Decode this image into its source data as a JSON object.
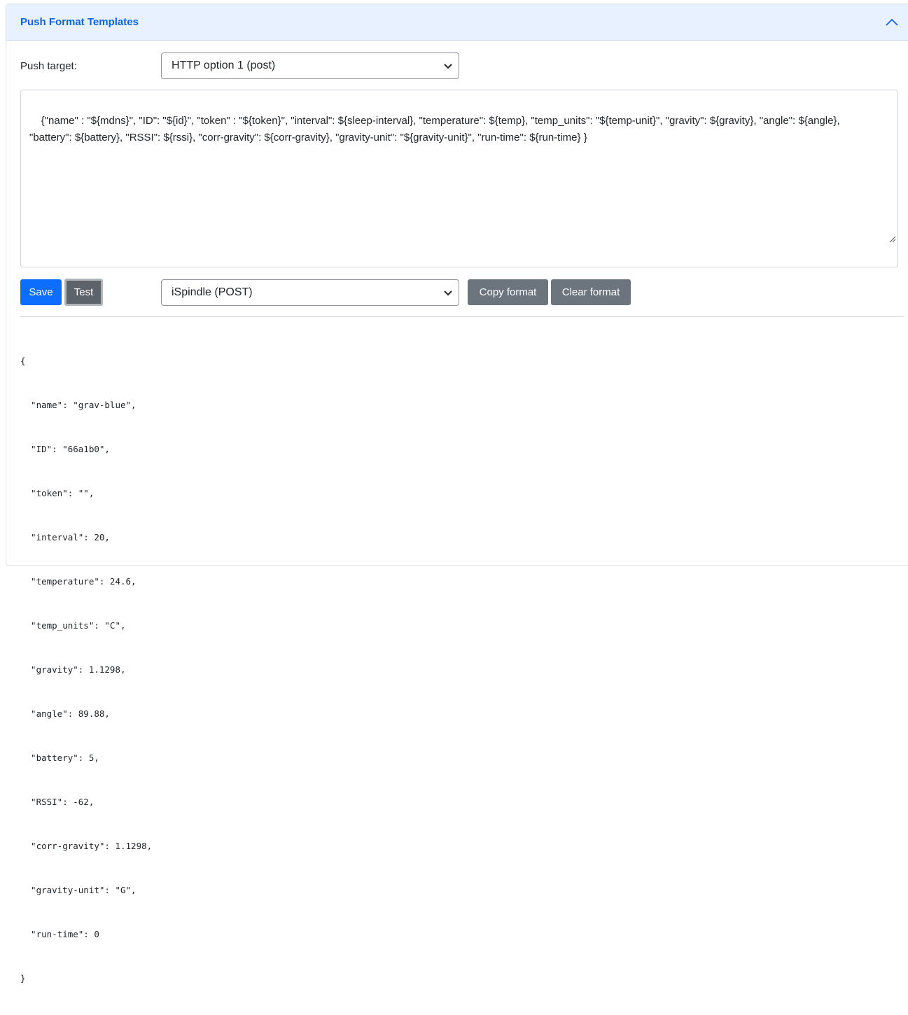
{
  "header": {
    "title": "Push Format Templates",
    "collapse_icon": "chevron-up-icon"
  },
  "push_target": {
    "label": "Push target:",
    "selected": "HTTP option 1 (post)"
  },
  "template_text": "{\"name\" : \"${mdns}\", \"ID\": \"${id}\", \"token\" : \"${token}\", \"interval\": ${sleep-interval}, \"temperature\": ${temp}, \"temp_units\": \"${temp-unit}\", \"gravity\": ${gravity}, \"angle\": ${angle},\n\"battery\": ${battery}, \"RSSI\": ${rssi}, \"corr-gravity\": ${corr-gravity}, \"gravity-unit\": \"${gravity-unit}\", \"run-time\": ${run-time} }",
  "actions": {
    "save_label": "Save",
    "test_label": "Test",
    "template_selected": "iSpindle (POST)",
    "copy_label": "Copy format",
    "clear_label": "Clear format"
  },
  "colors": {
    "primary": "#0d6efd",
    "secondary": "#6c757d",
    "header_bg": "#e7f1ff",
    "header_text": "#0c63e4"
  },
  "output": {
    "lines": [
      "{",
      "  \"name\": \"grav-blue\",",
      "  \"ID\": \"66a1b0\",",
      "  \"token\": \"\",",
      "  \"interval\": 20,",
      "  \"temperature\": 24.6,",
      "  \"temp_units\": \"C\",",
      "  \"gravity\": 1.1298,",
      "  \"angle\": 89.88,",
      "  \"battery\": 5,",
      "  \"RSSI\": -62,",
      "  \"corr-gravity\": 1.1298,",
      "  \"gravity-unit\": \"G\",",
      "  \"run-time\": 0",
      "}"
    ]
  }
}
